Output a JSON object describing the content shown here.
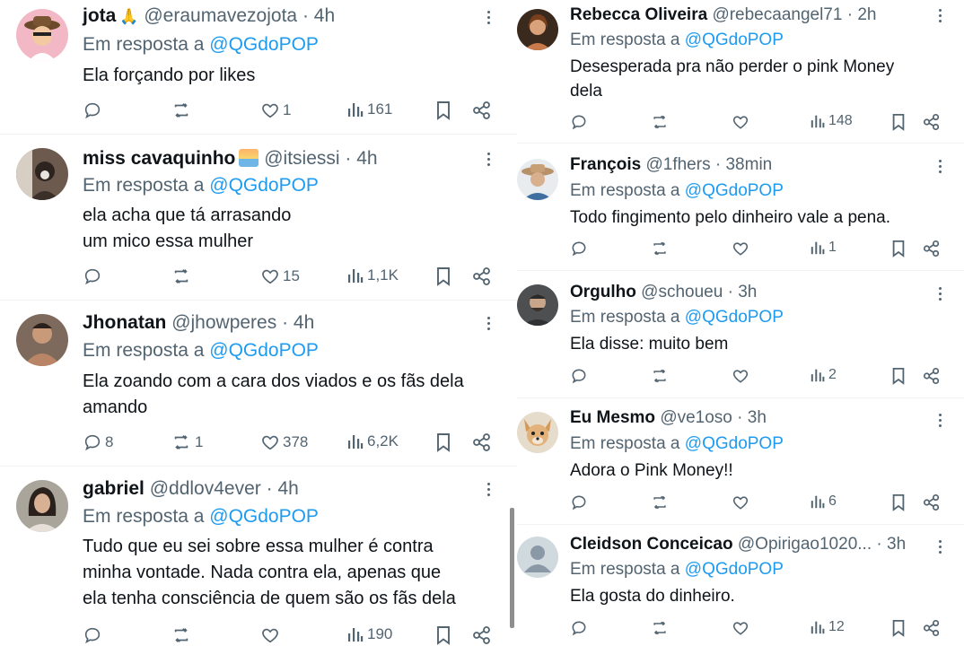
{
  "colors": {
    "name": "#0f1419",
    "muted": "#536471",
    "link": "#1d9bf0",
    "divider": "#eff3f4"
  },
  "icons": {
    "reply": "reply-icon",
    "retweet": "retweet-icon",
    "like": "heart-icon",
    "views": "views-icon",
    "bookmark": "bookmark-icon",
    "share": "share-icon",
    "more": "more-icon"
  },
  "left": [
    {
      "name": "jota",
      "badge": "🙏",
      "handle": "@eraumavezojota",
      "time": "4h",
      "reply_prefix": "Em resposta a",
      "mention": "@QGdoPOP",
      "lines": [
        "Ela forçando por likes"
      ],
      "replies": "",
      "retweets": "",
      "likes": "1",
      "views": "161"
    },
    {
      "name": "miss cavaquinho",
      "handle": "@itsiessi",
      "time": "4h",
      "reply_prefix": "Em resposta a",
      "mention": "@QGdoPOP",
      "lines": [
        "ela acha que tá arrasando",
        "um mico essa mulher"
      ],
      "replies": "",
      "retweets": "",
      "likes": "15",
      "views": "1,1K"
    },
    {
      "name": "Jhonatan",
      "handle": "@jhowperes",
      "time": "4h",
      "reply_prefix": "Em resposta a",
      "mention": "@QGdoPOP",
      "lines": [
        "Ela zoando com a cara dos viados e os fãs dela",
        "amando"
      ],
      "replies": "8",
      "retweets": "1",
      "likes": "378",
      "views": "6,2K"
    },
    {
      "name": "gabriel",
      "handle": "@ddlov4ever",
      "time": "4h",
      "reply_prefix": "Em resposta a",
      "mention": "@QGdoPOP",
      "lines": [
        "Tudo que eu sei sobre essa mulher é contra",
        "minha vontade. Nada contra ela, apenas que",
        "ela tenha consciência de quem são os fãs dela"
      ],
      "replies": "",
      "retweets": "",
      "likes": "",
      "views": "190"
    }
  ],
  "right": [
    {
      "name": "Rebecca Oliveira",
      "handle": "@rebecaangel71",
      "time": "2h",
      "reply_prefix": "Em resposta a",
      "mention": "@QGdoPOP",
      "lines": [
        "Desesperada pra não perder o pink Money",
        "dela"
      ],
      "replies": "",
      "retweets": "",
      "likes": "",
      "views": "148"
    },
    {
      "name": "François",
      "handle": "@1fhers",
      "time": "38min",
      "reply_prefix": "Em resposta a",
      "mention": "@QGdoPOP",
      "lines": [
        "Todo fingimento pelo dinheiro vale a pena."
      ],
      "replies": "",
      "retweets": "",
      "likes": "",
      "views": "1"
    },
    {
      "name": "Orgulho",
      "handle": "@schoueu",
      "time": "3h",
      "reply_prefix": "Em resposta a",
      "mention": "@QGdoPOP",
      "lines": [
        "Ela disse: muito bem"
      ],
      "replies": "",
      "retweets": "",
      "likes": "",
      "views": "2"
    },
    {
      "name": "Eu Mesmo",
      "handle": "@ve1oso",
      "time": "3h",
      "reply_prefix": "Em resposta a",
      "mention": "@QGdoPOP",
      "lines": [
        "Adora o Pink Money!!"
      ],
      "replies": "",
      "retweets": "",
      "likes": "",
      "views": "6"
    },
    {
      "name": "Cleidson Conceicao",
      "handle": "@Opirigao1020...",
      "time": "3h",
      "reply_prefix": "Em resposta a",
      "mention": "@QGdoPOP",
      "lines": [
        "Ela gosta do dinheiro."
      ],
      "replies": "",
      "retweets": "",
      "likes": "",
      "views": "12"
    }
  ]
}
